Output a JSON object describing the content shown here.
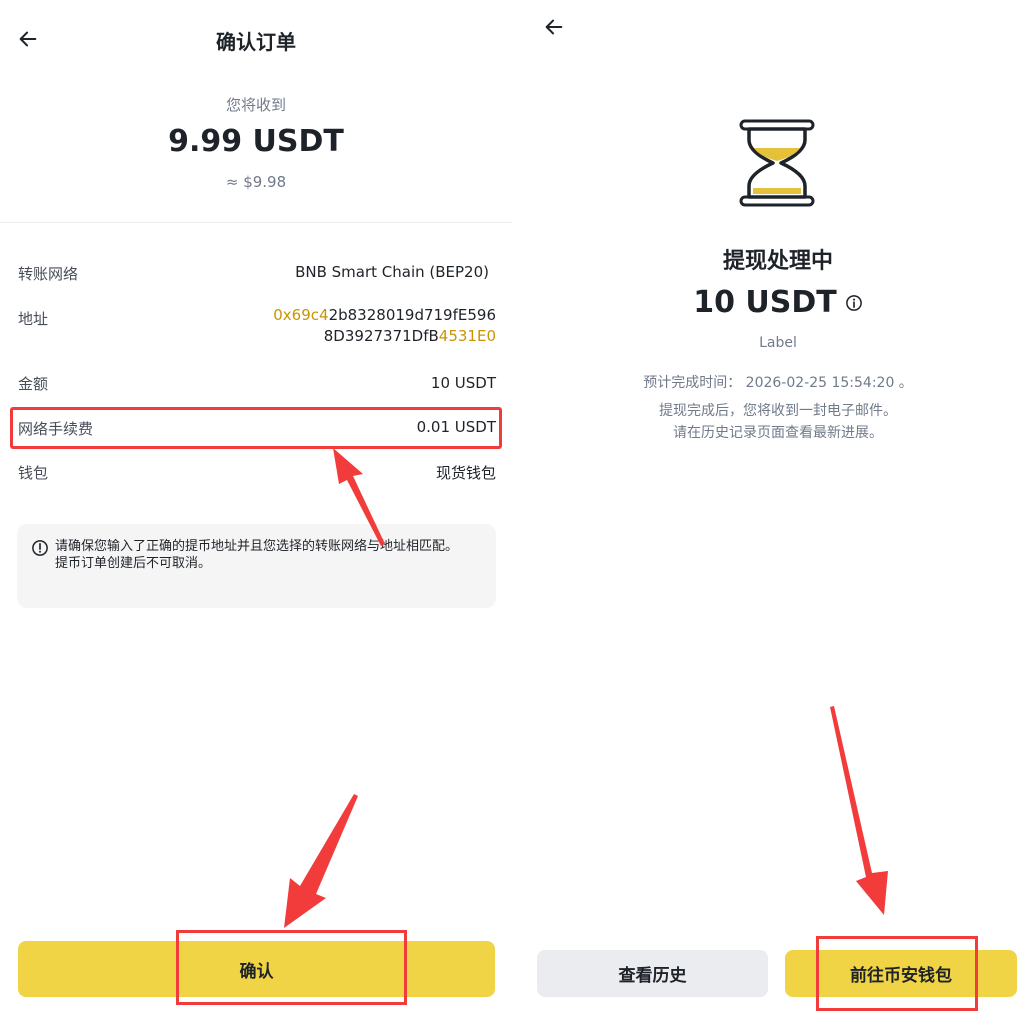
{
  "left": {
    "title": "确认订单",
    "receive_label": "您将收到",
    "receive_amount": "9.99 USDT",
    "receive_fiat": "≈ $9.98",
    "rows": {
      "network_label": "转账网络",
      "network_value": "BNB Smart Chain (BEP20)",
      "address_label": "地址",
      "address_prefix": "0x69c4",
      "address_mid1": "2b8328019d719fE596",
      "address_mid2": "8D3927371DfB",
      "address_suffix": "4531E0",
      "amount_label": "金额",
      "amount_value": "10 USDT",
      "fee_label": "网络手续费",
      "fee_value": "0.01 USDT",
      "wallet_label": "钱包",
      "wallet_value": "现货钱包"
    },
    "notice_line1": "请确保您输入了正确的提币地址并且您选择的转账网络与地址相匹配。",
    "notice_line2": "提币订单创建后不可取消。",
    "confirm_label": "确认"
  },
  "right": {
    "title": "提现处理中",
    "amount": "10 USDT",
    "label": "Label",
    "eta_label": "预计完成时间：",
    "eta_value": "2026-02-25 15:54:20 。",
    "message1": "提现完成后，您将收到一封电子邮件。",
    "message2": "请在历史记录页面查看最新进展。",
    "history_button": "查看历史",
    "wallet_button": "前往币安钱包"
  },
  "colors": {
    "accent_yellow": "#f0d445",
    "address_highlight": "#c99400",
    "annotation_red": "#f23b3b"
  }
}
